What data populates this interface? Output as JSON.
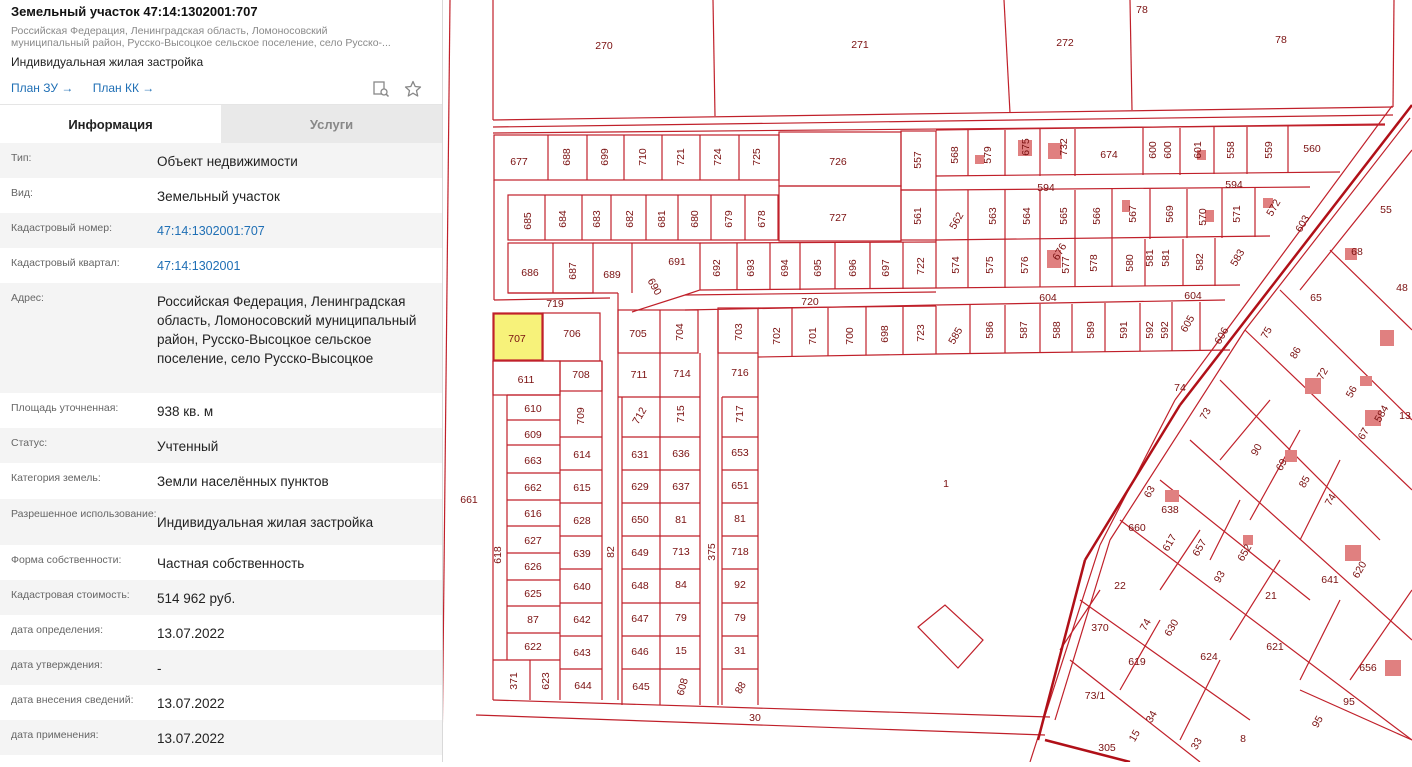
{
  "header": {
    "title": "Земельный участок 47:14:1302001:707",
    "address_line1": "Российская Федерация, Ленинградская область, Ломоносовский",
    "address_line2": "муниципальный район, Русско-Высоцкое сельское поселение, село Русско-...",
    "purpose": "Индивидуальная жилая застройка",
    "link_plan_zu": "План ЗУ →",
    "link_plan_kk": "План КК →"
  },
  "tabs": [
    {
      "label": "Информация"
    },
    {
      "label": "Услуги"
    }
  ],
  "info": [
    {
      "label": "Тип:",
      "value": "Объект недвижимости"
    },
    {
      "label": "Вид:",
      "value": "Земельный участок"
    },
    {
      "label": "Кадастровый номер:",
      "value": "47:14:1302001:707"
    },
    {
      "label": "Кадастровый квартал:",
      "value": "47:14:1302001"
    },
    {
      "label": "Адрес:",
      "value": "Российская Федерация, Ленинградская область, Ломоносовский муниципальный район, Русско-Высоцкое сельское поселение, село Русско-Высоцкое"
    },
    {
      "label": "Площадь уточненная:",
      "value": "938 кв. м"
    },
    {
      "label": "Статус:",
      "value": "Учтенный"
    },
    {
      "label": "Категория земель:",
      "value": "Земли населённых пунктов"
    },
    {
      "label": "Разрешенное использование:",
      "value": "Индивидуальная жилая застройка"
    },
    {
      "label": "Форма собственности:",
      "value": "Частная собственность"
    },
    {
      "label": "Кадастровая стоимость:",
      "value": "514 962 руб."
    },
    {
      "label": "дата определения:",
      "value": "13.07.2022"
    },
    {
      "label": "дата утверждения:",
      "value": "-"
    },
    {
      "label": "дата внесения сведений:",
      "value": "13.07.2022"
    },
    {
      "label": "дата применения:",
      "value": "13.07.2022"
    }
  ],
  "map": {
    "selected_parcel": "707",
    "colors": {
      "boundary": "#c0202a",
      "selected_fill": "#f7f27a",
      "building": "#e08080",
      "label": "#7a1010"
    },
    "labels": [
      "270",
      "271",
      "272",
      "78",
      "78",
      "677",
      "688",
      "699",
      "710",
      "721",
      "724",
      "725",
      "726",
      "557",
      "568",
      "579",
      "675",
      "732",
      "674",
      "600",
      "600",
      "601",
      "558",
      "559",
      "560",
      "594",
      "594",
      "685",
      "684",
      "683",
      "682",
      "681",
      "680",
      "679",
      "678",
      "727",
      "561",
      "562",
      "563",
      "564",
      "565",
      "566",
      "567",
      "569",
      "570",
      "571",
      "572",
      "603",
      "55",
      "686",
      "687",
      "689",
      "691",
      "690",
      "692",
      "693",
      "694",
      "695",
      "696",
      "697",
      "722",
      "574",
      "575",
      "576",
      "676",
      "577",
      "578",
      "580",
      "581",
      "581",
      "582",
      "583",
      "68",
      "48",
      "719",
      "720",
      "604",
      "604",
      "65",
      "707",
      "706",
      "705",
      "704",
      "703",
      "702",
      "701",
      "700",
      "698",
      "723",
      "585",
      "586",
      "587",
      "588",
      "589",
      "591",
      "592",
      "592",
      "605",
      "606",
      "75",
      "86",
      "72",
      "611",
      "708",
      "711",
      "714",
      "716",
      "74",
      "56",
      "584",
      "13",
      "610",
      "709",
      "712",
      "715",
      "717",
      "73",
      "67",
      "609",
      "663",
      "614",
      "631",
      "636",
      "653",
      "90",
      "69",
      "662",
      "615",
      "629",
      "637",
      "651",
      "63",
      "638",
      "70",
      "85",
      "74",
      "1",
      "661",
      "616",
      "628",
      "650",
      "81",
      "81",
      "660",
      "617",
      "627",
      "639",
      "649",
      "713",
      "718",
      "82",
      "375",
      "657",
      "652",
      "618",
      "626",
      "640",
      "648",
      "84",
      "92",
      "93",
      "22",
      "21",
      "641",
      "620",
      "625",
      "642",
      "647",
      "79",
      "79",
      "74",
      "630",
      "370",
      "87",
      "621",
      "624",
      "643",
      "646",
      "15",
      "31",
      "619",
      "656",
      "622",
      "623",
      "644",
      "645",
      "608",
      "88",
      "371",
      "73/1",
      "95",
      "30",
      "34",
      "15",
      "95",
      "8",
      "33",
      "305"
    ]
  }
}
